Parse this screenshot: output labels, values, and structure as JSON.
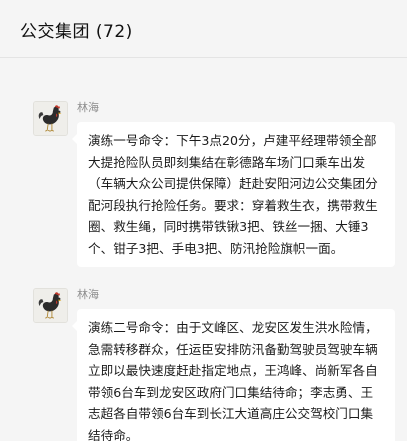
{
  "window": {
    "title": "公交集团 (72)"
  },
  "messages": [
    {
      "sender": "林海",
      "avatar_icon": "rooster-avatar-icon",
      "text": "演练一号命令：下午3点20分，卢建平经理带领全部大提抢险队员即刻集结在彰德路车场门口乘车出发（车辆大众公司提供保障）赶赴安阳河边公交集团分配河段执行抢险任务。要求：穿着救生衣，携带救生圈、救生绳，同时携带铁锹3把、铁丝一捆、大锤3个、钳子3把、手电3把、防汛抢险旗帜一面。"
    },
    {
      "sender": "林海",
      "avatar_icon": "rooster-avatar-icon",
      "text": "演练二号命令：由于文峰区、龙安区发生洪水险情，急需转移群众，任运臣安排防汛备勤驾驶员驾驶车辆立即以最快速度赶赴指定地点，王鸿峰、尚新军各自带领6台车到龙安区政府门口集结待命；李志勇、王志超各自带领6台车到长江大道高庄公交驾校门口集结待命。"
    }
  ],
  "colors": {
    "background": "#f5f5f5",
    "bubble": "#ffffff",
    "sender_name": "#8c8c8c"
  }
}
